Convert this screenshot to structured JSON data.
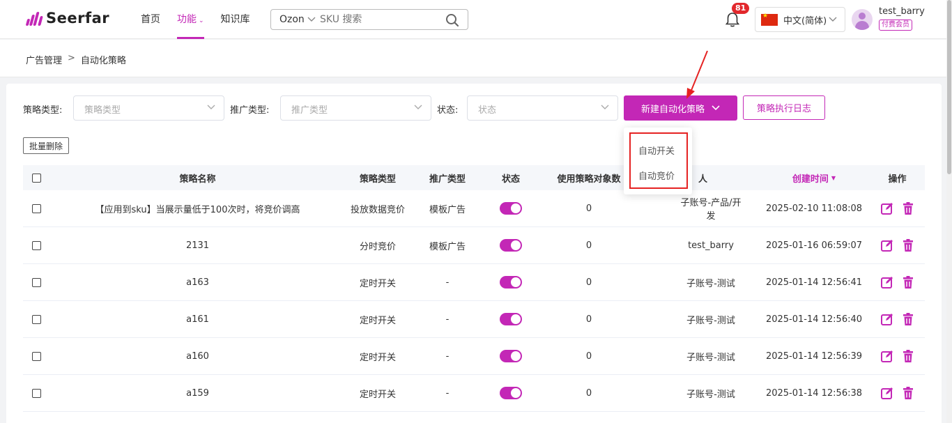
{
  "header": {
    "logo_text": "Seerfar",
    "nav": [
      {
        "label": "首页",
        "active": false
      },
      {
        "label": "功能",
        "active": true,
        "has_caret": true
      },
      {
        "label": "知识库",
        "active": false
      }
    ],
    "search": {
      "site": "Ozon",
      "placeholder": "SKU 搜索"
    },
    "notification_count": "81",
    "language": "中文(简体)",
    "username": "test_barry",
    "member_badge": "付费会员"
  },
  "breadcrumb": {
    "items": [
      "广告管理",
      "自动化策略"
    ],
    "separator": ">"
  },
  "filters": {
    "strategy_type": {
      "label": "策略类型:",
      "placeholder": "策略类型"
    },
    "promo_type": {
      "label": "推广类型:",
      "placeholder": "推广类型"
    },
    "status": {
      "label": "状态:",
      "placeholder": "状态"
    }
  },
  "toolbar": {
    "create_button": "新建自动化策略",
    "log_button": "策略执行日志",
    "batch_delete": "批量删除"
  },
  "dropdown": {
    "items": [
      "自动开关",
      "自动竞价"
    ]
  },
  "table": {
    "columns": [
      "策略名称",
      "策略类型",
      "推广类型",
      "状态",
      "使用策略对象数",
      "人",
      "创建时间",
      "操作"
    ],
    "sorted_column": "创建时间",
    "rows": [
      {
        "name": "【应用到sku】当展示量低于100次时，将竞价调高",
        "type": "投放数据竞价",
        "promo": "模板广告",
        "enabled": true,
        "count": "0",
        "creator": "子账号-产品/开发",
        "created": "2025-02-10 11:08:08"
      },
      {
        "name": "2131",
        "type": "分时竞价",
        "promo": "模板广告",
        "enabled": true,
        "count": "0",
        "creator": "test_barry",
        "created": "2025-01-16 06:59:07"
      },
      {
        "name": "a163",
        "type": "定时开关",
        "promo": "-",
        "enabled": true,
        "count": "0",
        "creator": "子账号-测试",
        "created": "2025-01-14 12:56:41"
      },
      {
        "name": "a161",
        "type": "定时开关",
        "promo": "-",
        "enabled": true,
        "count": "0",
        "creator": "子账号-测试",
        "created": "2025-01-14 12:56:40"
      },
      {
        "name": "a160",
        "type": "定时开关",
        "promo": "-",
        "enabled": true,
        "count": "0",
        "creator": "子账号-测试",
        "created": "2025-01-14 12:56:39"
      },
      {
        "name": "a159",
        "type": "定时开关",
        "promo": "-",
        "enabled": true,
        "count": "0",
        "creator": "子账号-测试",
        "created": "2025-01-14 12:56:38"
      }
    ]
  },
  "colors": {
    "accent": "#c327b6",
    "annotation": "#e52222",
    "badge": "#e2282c"
  }
}
